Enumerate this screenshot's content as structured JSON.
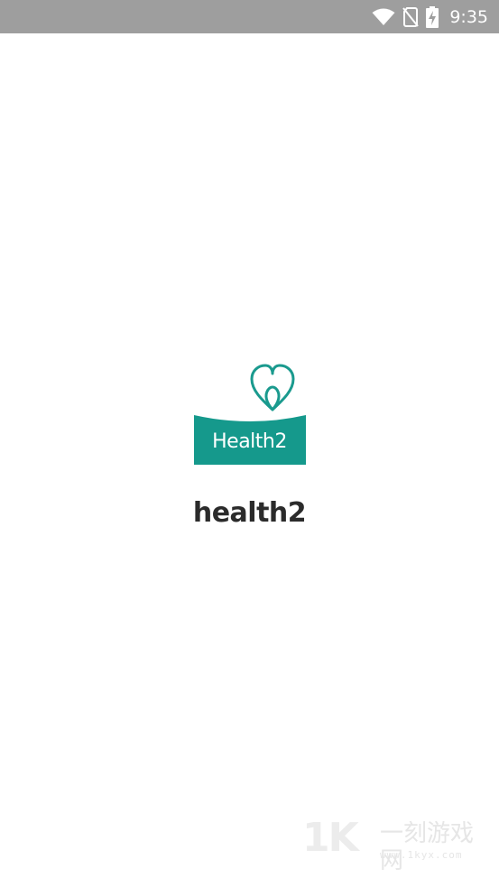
{
  "status_bar": {
    "time": "9:35",
    "icons": [
      "wifi-icon",
      "no-sim-icon",
      "battery-charging-icon"
    ]
  },
  "splash": {
    "logo_text": "Health2",
    "app_name": "health2"
  },
  "watermark": {
    "mark": "1K",
    "chinese": "一刻游戏网",
    "url": "www.1kyx.com"
  },
  "colors": {
    "status_bar_bg": "#9e9e9e",
    "brand_teal": "#15998c",
    "heart_teal": "#1a9a8e",
    "title_text": "#2b2b2b"
  }
}
